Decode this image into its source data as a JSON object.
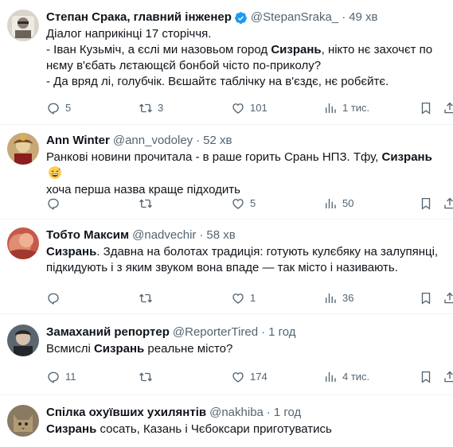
{
  "colors": {
    "text": "#0f1419",
    "muted": "#536471",
    "blue": "#1d9bf0",
    "border": "#eff3f4"
  },
  "tweets": [
    {
      "name": "Степан Срака, главний інженер",
      "verified": true,
      "handle": "@StepanSraka_",
      "dot": "·",
      "time": "49 хв",
      "lines": [
        [
          {
            "t": "Діалог наприкінці 17 сторіччя."
          }
        ],
        [
          {
            "t": "- Іван Кузьміч, а єслі ми назовьом город "
          },
          {
            "t": "Сизрань",
            "b": true
          },
          {
            "t": ", нікто нє захочєт по"
          }
        ],
        [
          {
            "t": "нєму в'єбать лєтающєй бонбой чісто по-приколу?"
          }
        ],
        [
          {
            "t": "- Да вряд лі, голубчік. Вєшайтє таблічку на в'єздє, нє робєйтє."
          }
        ]
      ],
      "stats": {
        "replies": "5",
        "retweets": "3",
        "likes": "101",
        "views": "1 тис."
      }
    },
    {
      "name": "Ann Winter",
      "verified": false,
      "handle": "@ann_vodoley",
      "dot": "·",
      "time": "52 хв",
      "lines": [
        [
          {
            "t": "Ранкові новини прочитала - в раше горить Срань НПЗ. Тфу, "
          },
          {
            "t": "Сизрань",
            "b": true
          },
          {
            "emoji": "grinning-sweat-emoji"
          }
        ],
        [
          {
            "t": "хоча перша назва краще підходить"
          }
        ]
      ],
      "stats": {
        "replies": "",
        "retweets": "",
        "likes": "5",
        "views": "50"
      }
    },
    {
      "name": "Тобто Максим",
      "verified": false,
      "handle": "@nadvechir",
      "dot": "·",
      "time": "58 хв",
      "lines": [
        [
          {
            "t": "Сизрань",
            "b": true
          },
          {
            "t": ". Здавна на болотах традиція: готують кулєбяку на залупянці,"
          }
        ],
        [
          {
            "t": "підкидують і з яким звуком вона впаде — так місто і називають."
          }
        ]
      ],
      "stats": {
        "replies": "",
        "retweets": "",
        "likes": "1",
        "views": "36"
      }
    },
    {
      "name": "Замаханий репортер",
      "verified": false,
      "handle": "@ReporterTired",
      "dot": "·",
      "time": "1 год",
      "lines": [
        [
          {
            "t": "Всмислі "
          },
          {
            "t": "Сизрань",
            "b": true
          },
          {
            "t": " реальне місто?"
          }
        ]
      ],
      "stats": {
        "replies": "11",
        "retweets": "",
        "likes": "174",
        "views": "4 тис."
      }
    },
    {
      "name": "Спілка охуївших ухилянтів",
      "verified": false,
      "handle": "@nakhiba",
      "dot": "·",
      "time": "1 год",
      "lines": [
        [
          {
            "t": "Сизрань",
            "b": true
          },
          {
            "t": " сосать, Казань і Чєбоксари приготуватись"
          }
        ]
      ],
      "stats": null
    }
  ]
}
